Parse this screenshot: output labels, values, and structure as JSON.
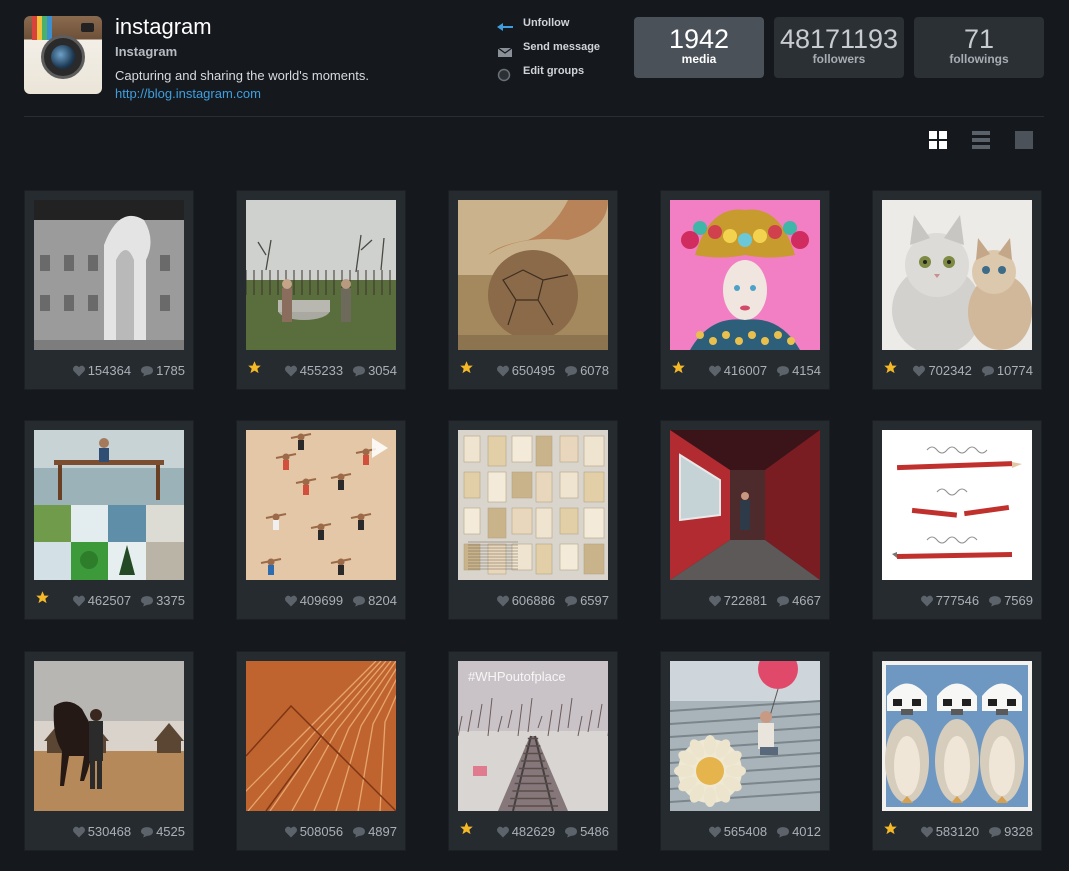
{
  "profile": {
    "username": "instagram",
    "full_name": "Instagram",
    "bio": "Capturing and sharing the world's moments.",
    "link": "http://blog.instagram.com"
  },
  "actions": {
    "unfollow": "Unfollow",
    "send_message": "Send message",
    "edit_groups": "Edit groups"
  },
  "stats": {
    "media": {
      "value": "1942",
      "label": "media"
    },
    "followers": {
      "value": "48171193",
      "label": "followers"
    },
    "followings": {
      "value": "71",
      "label": "followings"
    }
  },
  "view_modes": [
    "grid",
    "list",
    "single"
  ],
  "colors": {
    "accent_link": "#3d9fe0",
    "star": "#f5b927",
    "background": "#15181c",
    "card": "#262b30"
  },
  "posts": [
    {
      "likes": "154364",
      "comments": "1785",
      "starred": false,
      "subject": "3d-printed-house"
    },
    {
      "likes": "455233",
      "comments": "3054",
      "starred": true,
      "subject": "village-women-bathtub"
    },
    {
      "likes": "650495",
      "comments": "6078",
      "starred": true,
      "subject": "foot-on-football"
    },
    {
      "likes": "416007",
      "comments": "4154",
      "starred": true,
      "subject": "jeweled-portrait"
    },
    {
      "likes": "702342",
      "comments": "10774",
      "starred": true,
      "subject": "two-cats"
    },
    {
      "likes": "462507",
      "comments": "3375",
      "starred": true,
      "subject": "collage-beach-desk"
    },
    {
      "likes": "409699",
      "comments": "8204",
      "starred": false,
      "subject": "beach-exercise-video"
    },
    {
      "likes": "606886",
      "comments": "6597",
      "starred": false,
      "subject": "vintage-papers"
    },
    {
      "likes": "722881",
      "comments": "4667",
      "starred": false,
      "subject": "train-corridor"
    },
    {
      "likes": "777546",
      "comments": "7569",
      "starred": false,
      "subject": "pencils-yesterday-today-tomorrow"
    },
    {
      "likes": "530468",
      "comments": "4525",
      "starred": false,
      "subject": "horse-and-rider"
    },
    {
      "likes": "508056",
      "comments": "4897",
      "starred": false,
      "subject": "copper-texture"
    },
    {
      "likes": "482629",
      "comments": "5486",
      "starred": true,
      "subject": "railway-tracks"
    },
    {
      "likes": "565408",
      "comments": "4012",
      "starred": false,
      "subject": "girl-balloon-flower"
    },
    {
      "likes": "583120",
      "comments": "9328",
      "starred": true,
      "subject": "stormtrooper-penguins"
    }
  ],
  "photo_texts": {
    "pencil_words": [
      "yesterday",
      "today",
      "tomorrow"
    ],
    "railway_hashtag": "#WHPoutofplace"
  }
}
